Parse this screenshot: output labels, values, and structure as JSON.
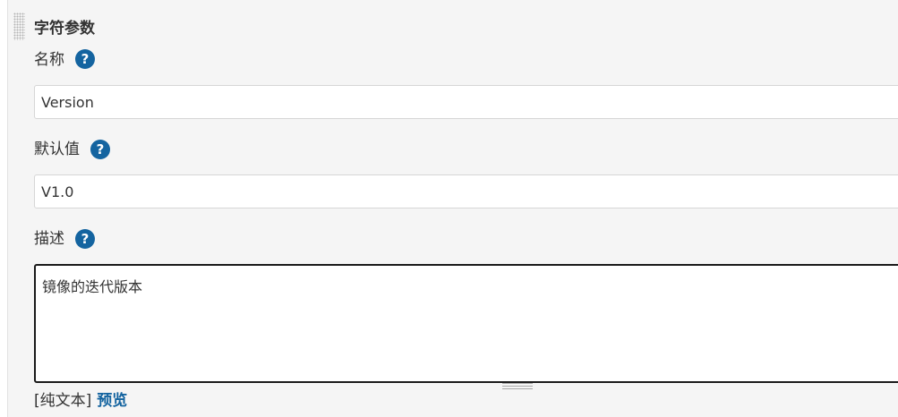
{
  "section": {
    "title": "字符参数"
  },
  "fields": {
    "name": {
      "label": "名称",
      "value": "Version",
      "help_icon": "question-icon"
    },
    "default_value": {
      "label": "默认值",
      "value": "V1.0",
      "help_icon": "question-icon"
    },
    "description": {
      "label": "描述",
      "value": "镜像的迭代版本",
      "help_icon": "question-icon"
    }
  },
  "footer": {
    "plain_text_label": "[纯文本]",
    "preview_link": "预览"
  },
  "help_glyph": "?",
  "colors": {
    "accent": "#1464a0",
    "background": "#f5f5f5",
    "text": "#333333"
  }
}
